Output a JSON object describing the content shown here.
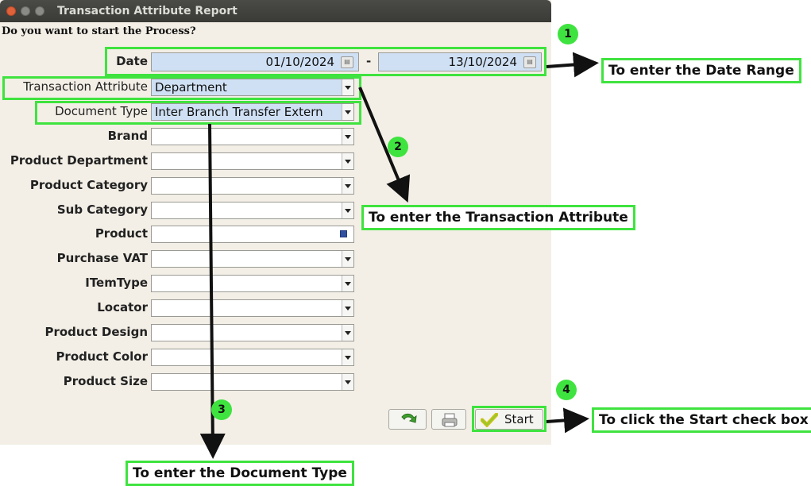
{
  "window": {
    "title": "Transaction Attribute Report",
    "prompt": "Do you want to start the Process?"
  },
  "form": {
    "date_label": "Date",
    "date_from": "01/10/2024",
    "date_to": "13/10/2024",
    "date_separator": "-",
    "fields": [
      {
        "label": "Transaction Attribute",
        "value": "Department"
      },
      {
        "label": "Document Type",
        "value": "Inter Branch Transfer Extern"
      },
      {
        "label": "Brand",
        "value": ""
      },
      {
        "label": "Product Department",
        "value": ""
      },
      {
        "label": "Product Category",
        "value": ""
      },
      {
        "label": "Sub Category",
        "value": ""
      },
      {
        "label": "Product",
        "value": ""
      },
      {
        "label": "Purchase VAT",
        "value": ""
      },
      {
        "label": "ITemType",
        "value": ""
      },
      {
        "label": "Locator",
        "value": ""
      },
      {
        "label": "Product Design",
        "value": ""
      },
      {
        "label": "Product Color",
        "value": ""
      },
      {
        "label": "Product Size",
        "value": ""
      }
    ]
  },
  "toolbar": {
    "start_label": "Start",
    "icons": [
      "arrow-right-icon",
      "print-icon",
      "checkmark-icon"
    ]
  },
  "annotations": {
    "badges": [
      "1",
      "2",
      "3",
      "4"
    ],
    "callouts": [
      "To enter the Date Range",
      "To enter the  Transaction Attribute",
      "To enter the Document Type",
      "To click the Start check box"
    ]
  },
  "colors": {
    "highlight": "#3fe33f",
    "field_fill": "#cfe0f4",
    "window_bg": "#f3efe6",
    "titlebar": "#3e3e3a"
  }
}
